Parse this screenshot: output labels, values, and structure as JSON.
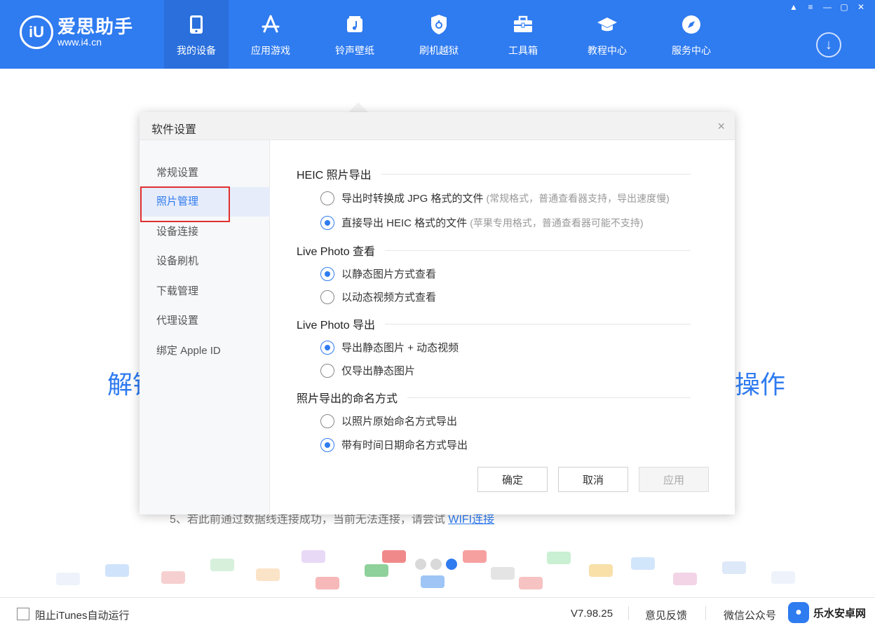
{
  "app": {
    "logo_mark": "iU",
    "name": "爱思助手",
    "url": "www.i4.cn"
  },
  "nav": [
    {
      "label": "我的设备",
      "icon": "phone-icon",
      "active": true
    },
    {
      "label": "应用游戏",
      "icon": "app-store-icon"
    },
    {
      "label": "铃声壁纸",
      "icon": "music-note-icon"
    },
    {
      "label": "刷机越狱",
      "icon": "shield-icon"
    },
    {
      "label": "工具箱",
      "icon": "toolbox-icon"
    },
    {
      "label": "教程中心",
      "icon": "graduation-cap-icon"
    },
    {
      "label": "服务中心",
      "icon": "compass-icon"
    }
  ],
  "window_controls": [
    "shirt-icon",
    "menu-icon",
    "minimize-icon",
    "maximize-icon",
    "close-icon"
  ],
  "background": {
    "left_text": "解锁",
    "right_text": "操作",
    "hint_prefix": "5、若此前通过数据线连接成功，当前无法连接，请尝试",
    "hint_link": "WIFI连接"
  },
  "dialog": {
    "title": "软件设置",
    "close": "×",
    "sidebar": [
      {
        "label": "常规设置"
      },
      {
        "label": "照片管理",
        "active": true
      },
      {
        "label": "设备连接"
      },
      {
        "label": "设备刷机"
      },
      {
        "label": "下载管理"
      },
      {
        "label": "代理设置"
      },
      {
        "label": "绑定 Apple ID"
      }
    ],
    "sections": [
      {
        "title": "HEIC 照片导出",
        "options": [
          {
            "label": "导出时转换成 JPG 格式的文件",
            "note": "(常规格式，普通查看器支持，导出速度慢)",
            "selected": false
          },
          {
            "label": "直接导出 HEIC 格式的文件",
            "note": "(苹果专用格式，普通查看器可能不支持)",
            "selected": true
          }
        ]
      },
      {
        "title": "Live Photo 查看",
        "options": [
          {
            "label": "以静态图片方式查看",
            "note": "",
            "selected": true
          },
          {
            "label": "以动态视频方式查看",
            "note": "",
            "selected": false
          }
        ]
      },
      {
        "title": "Live Photo 导出",
        "options": [
          {
            "label": "导出静态图片 + 动态视频",
            "note": "",
            "selected": true
          },
          {
            "label": "仅导出静态图片",
            "note": "",
            "selected": false
          }
        ]
      },
      {
        "title": "照片导出的命名方式",
        "options": [
          {
            "label": "以照片原始命名方式导出",
            "note": "",
            "selected": false
          },
          {
            "label": "带有时间日期命名方式导出",
            "note": "",
            "selected": true
          }
        ]
      }
    ],
    "buttons": {
      "confirm": "确定",
      "cancel": "取消",
      "apply": "应用"
    }
  },
  "statusbar": {
    "itunes_label": "阻止iTunes自动运行",
    "itunes_checked": false,
    "version": "V7.98.25",
    "feedback": "意见反馈",
    "wechat": "微信公众号",
    "brand": "乐水安卓网"
  }
}
